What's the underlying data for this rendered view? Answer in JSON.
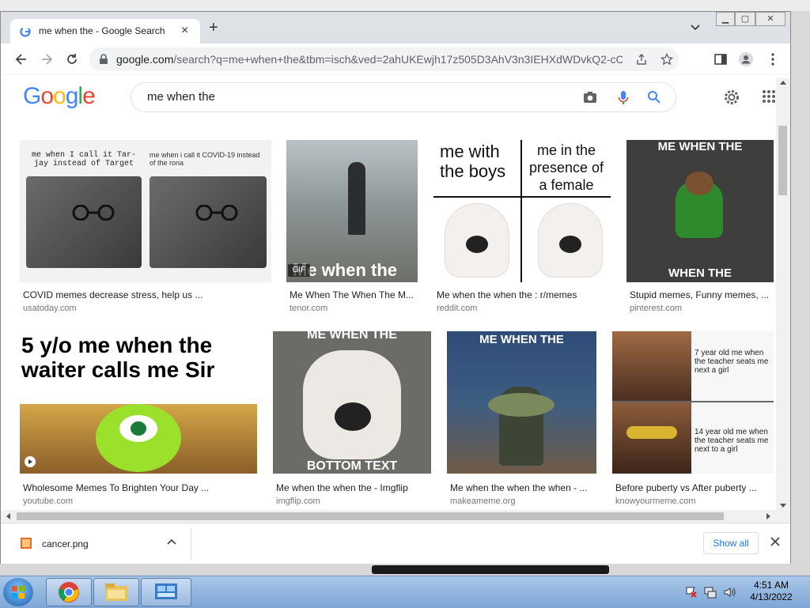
{
  "browser": {
    "tab_title": "me when the - Google Search",
    "url_host": "google.com",
    "url_rest": "/search?q=me+when+the&tbm=isch&ved=2ahUKEwjh17z505D3AhV3n3IEHXdWDvkQ2-cCegQ...",
    "colors": {
      "tabstrip": "#dee1e6",
      "accent": "#1a73e8"
    }
  },
  "google": {
    "logo_letters": [
      "G",
      "o",
      "o",
      "g",
      "l",
      "e"
    ],
    "logo_colors": [
      "#4285f4",
      "#ea4335",
      "#fbbc05",
      "#4285f4",
      "#34a853",
      "#ea4335"
    ],
    "query": "me when the"
  },
  "results": [
    {
      "title": "COVID memes decrease stress, help us ...",
      "site": "usatoday.com",
      "caption_left": "me when I call it Tar-jay instead of Target",
      "caption_right": "me when i call it COVID-19 instead of the rona"
    },
    {
      "title": "Me When The When The M...",
      "site": "tenor.com",
      "overlay_text": "Me when the",
      "badge": "GIF"
    },
    {
      "title": "Me when the when the : r/memes",
      "site": "reddit.com",
      "caption_left": "me with the boys",
      "caption_right": "me in the presence of a female"
    },
    {
      "title": "Stupid memes, Funny memes, ...",
      "site": "pinterest.com",
      "top_text": "ME WHEN THE",
      "bottom_text": "WHEN THE"
    },
    {
      "title": "Wholesome Memes To Brighten Your Day ...",
      "site": "youtube.com",
      "caption": "5 y/o me when the waiter calls me Sir"
    },
    {
      "title": "Me when the when the - Imgflip",
      "site": "imgflip.com",
      "top_text": "ME WHEN THE",
      "bottom_text": "BOTTOM TEXT"
    },
    {
      "title": "Me when the when the when - ...",
      "site": "makeameme.org",
      "top_text": "ME WHEN THE"
    },
    {
      "title": "Before puberty vs After puberty ...",
      "site": "knowyourmeme.com",
      "caption_top": "7 year old me when the teacher seats me next a girl",
      "caption_bottom": "14 year old me when the teacher seats me next to a girl"
    }
  ],
  "downloads": {
    "file_name": "cancer.png",
    "show_all_label": "Show all"
  },
  "taskbar": {
    "time": "4:51 AM",
    "date": "4/13/2022"
  }
}
